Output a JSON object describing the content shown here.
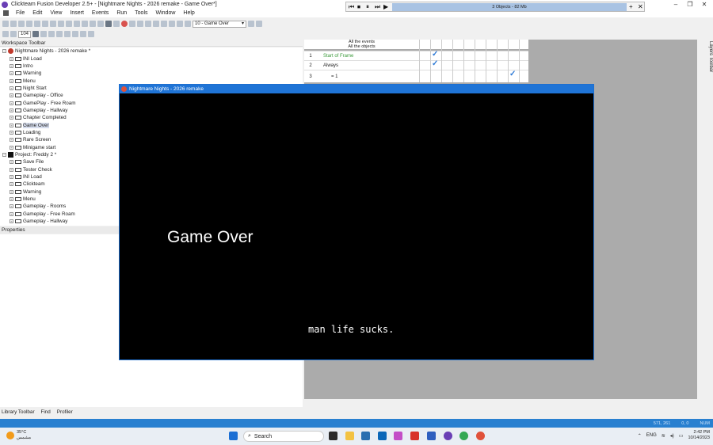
{
  "app": {
    "title": "Clickteam Fusion Developer 2.5+ - [Nightmare Nights - 2026 remake - Game Over*]",
    "window_controls": [
      "–",
      "❐",
      "✕"
    ]
  },
  "menu": [
    "File",
    "Edit",
    "View",
    "Insert",
    "Events",
    "Run",
    "Tools",
    "Window",
    "Help"
  ],
  "toolbar": {
    "zoom_value": "104",
    "frame_select": "10 - Game Over"
  },
  "player": {
    "status": "3 Objects - 82 Mb"
  },
  "workspace": {
    "title": "Workspace Toolbar",
    "items": [
      {
        "label": "Nightmare Nights - 2026 remake *",
        "type": "app"
      },
      {
        "label": "INI Load",
        "type": "frame"
      },
      {
        "label": "Intro",
        "type": "frame"
      },
      {
        "label": "Warning",
        "type": "frame"
      },
      {
        "label": "Menu",
        "type": "frame"
      },
      {
        "label": "Night Start",
        "type": "frame"
      },
      {
        "label": "Gameplay - Office",
        "type": "frame"
      },
      {
        "label": "GamePlay - Free Roam",
        "type": "frame"
      },
      {
        "label": "Gameplay - Hallway",
        "type": "frame"
      },
      {
        "label": "Chapter Completed",
        "type": "frame"
      },
      {
        "label": "Game Over",
        "type": "frame",
        "selected": true
      },
      {
        "label": "Loading",
        "type": "frame"
      },
      {
        "label": "Rare Screen",
        "type": "frame"
      },
      {
        "label": "Minigame start",
        "type": "frame"
      },
      {
        "label": "Project: Freddy 2 *",
        "type": "app2"
      },
      {
        "label": "Save File",
        "type": "frame"
      },
      {
        "label": "Tester Check",
        "type": "frame"
      },
      {
        "label": "INI Load",
        "type": "frame"
      },
      {
        "label": "Clickteam",
        "type": "frame"
      },
      {
        "label": "Warning",
        "type": "frame"
      },
      {
        "label": "Menu",
        "type": "frame"
      },
      {
        "label": "Gameplay - Rooms",
        "type": "frame"
      },
      {
        "label": "Gameplay - Free Roam",
        "type": "frame"
      },
      {
        "label": "Gameplay - Hallway",
        "type": "frame"
      }
    ]
  },
  "properties": {
    "title": "Properties"
  },
  "bottom_tabs": [
    "Library Toolbar",
    "Find",
    "Profiler"
  ],
  "events": {
    "header_line1": "All the events",
    "header_line2": "All the objects",
    "rows": [
      {
        "num": "1",
        "text": "Start of Frame"
      },
      {
        "num": "2",
        "text": "Always"
      },
      {
        "num": "3",
        "text": "= 1"
      }
    ]
  },
  "layers_toolbar": "Layers Toolbar",
  "game_window": {
    "title": "Nightmare Nights - 2026 remake",
    "heading": "Game Over",
    "subtitle": "man life sucks."
  },
  "statusbar": {
    "items": [
      "571, 261",
      "0, 0",
      "NUM"
    ]
  },
  "taskbar": {
    "weather_temp": "35°C",
    "weather_desc": "مشمس",
    "search_label": "Search",
    "lang": "ENG",
    "time": "2:42 PM",
    "date": "10/14/2023"
  },
  "colors": {
    "accent": "#1f74d6",
    "statusbar": "#2980d0",
    "check": "#2f7bd6"
  }
}
